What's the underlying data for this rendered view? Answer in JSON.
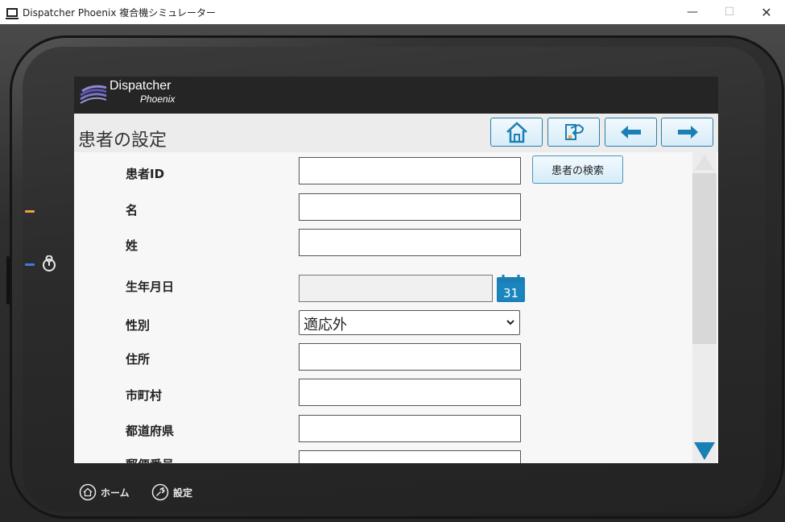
{
  "window": {
    "title": "Dispatcher Phoenix 複合機シミュレーター",
    "controls": {
      "minimize": "—",
      "maximize": "☐",
      "close": "✕"
    }
  },
  "app": {
    "logo_line1": "Dispatcher",
    "logo_line2": "Phoenix",
    "page_title": "患者の設定"
  },
  "nav": [
    {
      "name": "home-icon"
    },
    {
      "name": "exit-icon"
    },
    {
      "name": "back-arrow-icon"
    },
    {
      "name": "forward-arrow-icon"
    }
  ],
  "form": {
    "patient_id_label": "患者ID",
    "patient_id_value": "",
    "search_button": "患者の検索",
    "first_name_label": "名",
    "first_name_value": "",
    "last_name_label": "姓",
    "last_name_value": "",
    "birthdate_label": "生年月日",
    "birthdate_value": "",
    "calendar_day": "31",
    "gender_label": "性別",
    "gender_value": "適応外",
    "address_label": "住所",
    "address_value": "",
    "city_label": "市町村",
    "city_value": "",
    "prefecture_label": "都道府県",
    "prefecture_value": "",
    "postal_label": "郵便番号",
    "postal_value": ""
  },
  "device_bar": {
    "home_label": "ホーム",
    "settings_label": "設定"
  },
  "colors": {
    "accent": "#1a7fb5",
    "led_orange": "#f0a040",
    "led_blue": "#3a7de0"
  }
}
